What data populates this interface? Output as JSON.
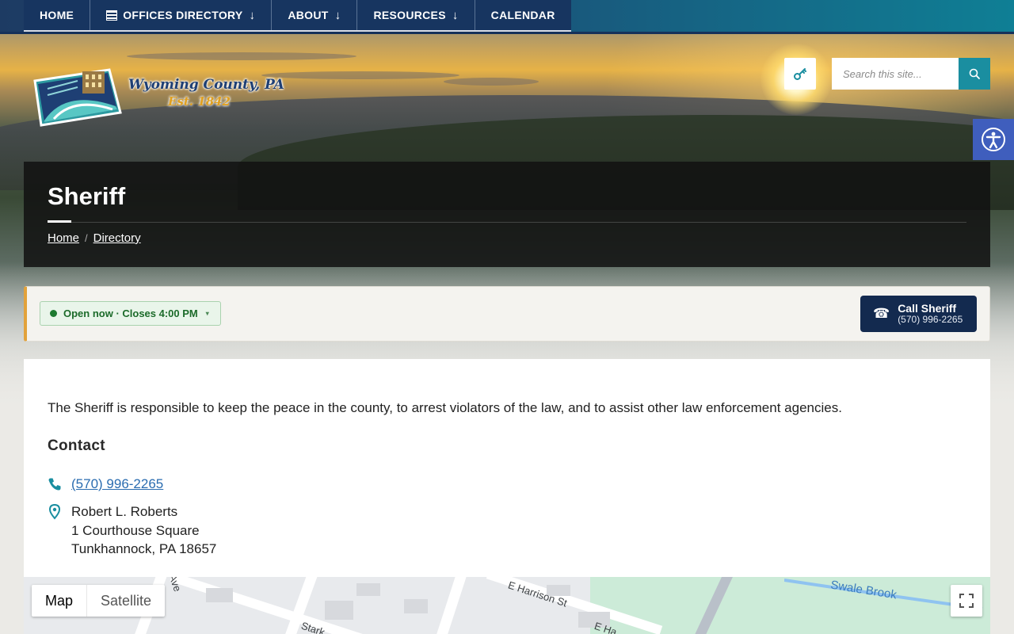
{
  "nav": {
    "items": [
      {
        "label": "HOME"
      },
      {
        "label": "OFFICES DIRECTORY",
        "icon": "list-icon",
        "arrow": "↓"
      },
      {
        "label": "ABOUT",
        "arrow": "↓"
      },
      {
        "label": "RESOURCES",
        "arrow": "↓"
      },
      {
        "label": "CALENDAR"
      }
    ]
  },
  "logo": {
    "name": "Wyoming County, PA",
    "est": "Est. 1842"
  },
  "search": {
    "placeholder": "Search this site...",
    "icon": "search-icon"
  },
  "accessibility": {
    "icon": "accessibility-icon"
  },
  "page": {
    "title": "Sheriff",
    "breadcrumb": [
      {
        "label": "Home"
      },
      {
        "label": "Directory"
      }
    ],
    "breadcrumb_sep": "/"
  },
  "status": {
    "open_text": "Open now · Closes 4:00 PM",
    "caret": "▾",
    "call_label": "Call Sheriff",
    "call_number": "(570) 996-2265",
    "call_icon": "☎"
  },
  "content": {
    "description": "The Sheriff is responsible to keep the peace in the county, to arrest violators of the law, and to assist other law enforcement agencies.",
    "contact_heading": "Contact",
    "phone": "(570) 996-2265",
    "address": [
      "Robert L. Roberts",
      "1 Courthouse Square",
      "Tunkhannock, PA 18657"
    ]
  },
  "map": {
    "toggle": [
      "Map",
      "Satellite"
    ],
    "labels": [
      "E Harrison St",
      "Swale Brook",
      "E Ha",
      "Stark",
      "Ave"
    ]
  },
  "colors": {
    "nav_bg": "#173560",
    "accent_teal": "#1a8ea0",
    "status_border": "#e2a23b",
    "call_bg": "#132a4f"
  }
}
